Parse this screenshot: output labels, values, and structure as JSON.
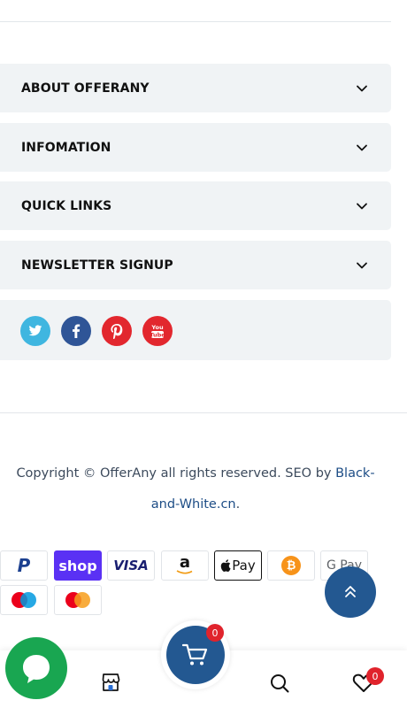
{
  "accordion": [
    {
      "label": "ABOUT OFFERANY"
    },
    {
      "label": "INFOMATION"
    },
    {
      "label": "QUICK LINKS"
    },
    {
      "label": "NEWSLETTER SIGNUP"
    }
  ],
  "social": [
    {
      "icon": "twitter-icon",
      "color": "#3fb6e0"
    },
    {
      "icon": "facebook-icon",
      "color": "#2f5597"
    },
    {
      "icon": "pinterest-icon",
      "color": "#e2272e"
    },
    {
      "icon": "youtube-icon",
      "color": "#e2272e"
    }
  ],
  "footer": {
    "copyright_text": "Copyright © OfferAny all rights reserved. SEO by ",
    "link_part1": "Black-",
    "link_part2": "and-White.cn",
    "period": "."
  },
  "payments": {
    "paypal": "P",
    "shop": "shop",
    "visa": "VISA",
    "amazon": "a",
    "applepay": "Pay",
    "bitcoin": "₿",
    "gpay": "G Pay"
  },
  "cart": {
    "count": "0"
  },
  "wishlist": {
    "count": "0"
  },
  "colors": {
    "accent": "#235891",
    "panel": "#f0f3f5",
    "badge": "#e0232c",
    "chat": "#19a651",
    "link": "#1d4d86"
  }
}
